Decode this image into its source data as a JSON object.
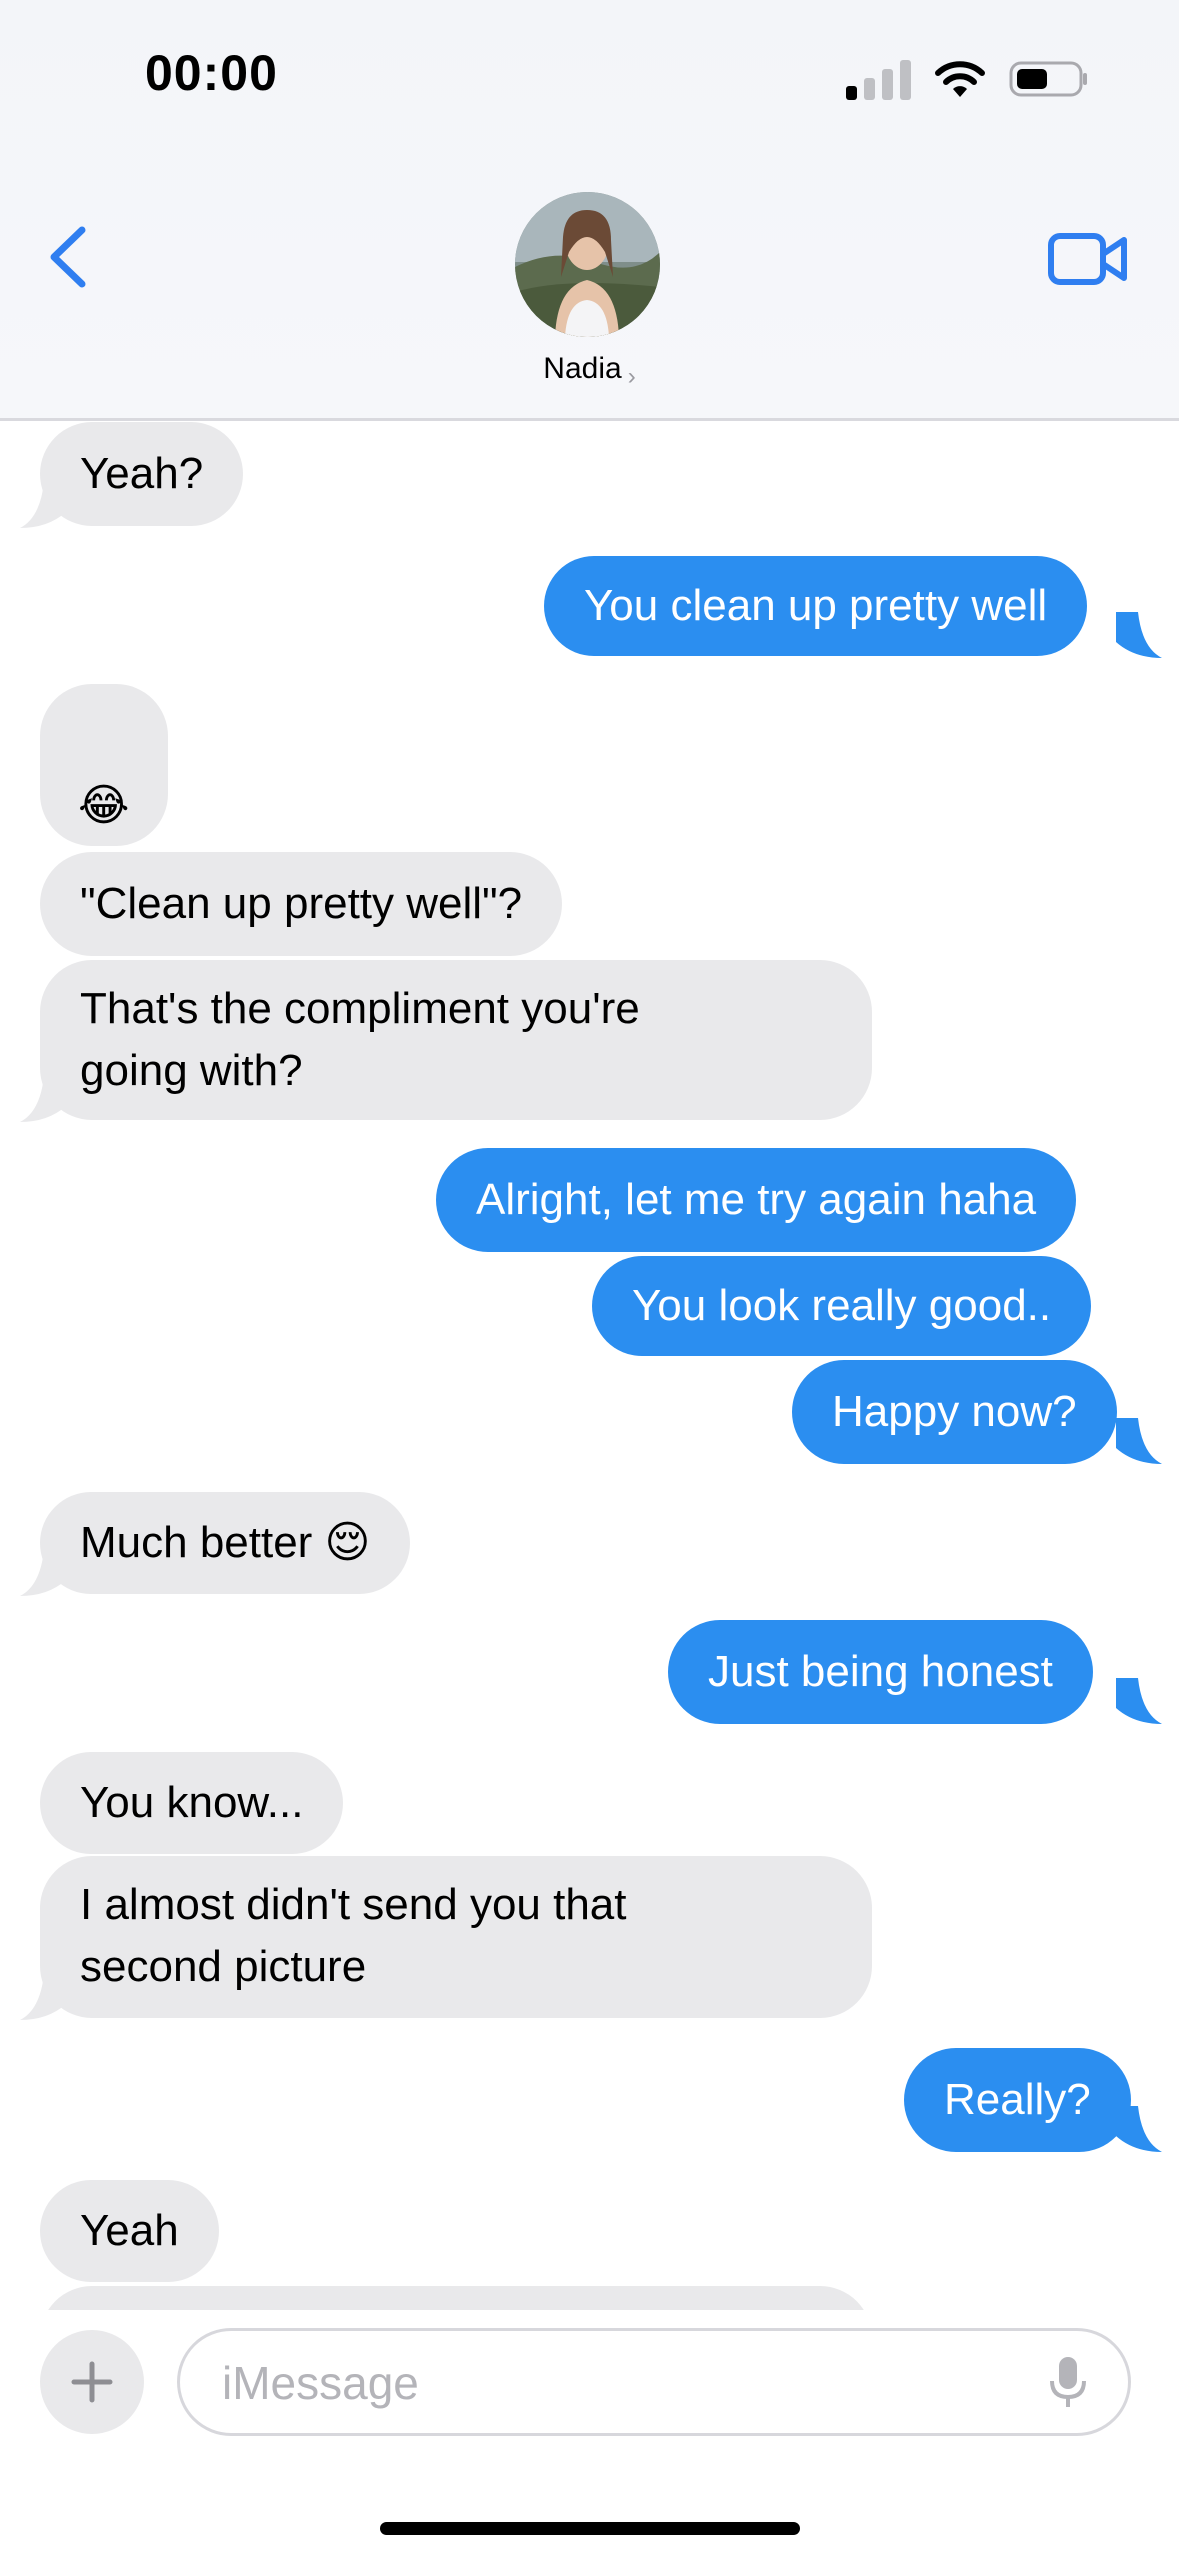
{
  "status_bar": {
    "time": "00:00",
    "battery_level": 0.5
  },
  "header": {
    "contact_name": "Nadia"
  },
  "messages": [
    {
      "from": "them",
      "text": "Yeah?"
    },
    {
      "from": "me",
      "text": "You clean up pretty well"
    },
    {
      "from": "them",
      "text": "😂"
    },
    {
      "from": "them",
      "text": "\"Clean up pretty well\"?"
    },
    {
      "from": "them",
      "line1": "That's the compliment you're",
      "line2": "going with?"
    },
    {
      "from": "me",
      "text": "Alright, let me try again haha"
    },
    {
      "from": "me",
      "text": "You look really good.."
    },
    {
      "from": "me",
      "text": "Happy now?"
    },
    {
      "from": "them",
      "text": "Much better 😌"
    },
    {
      "from": "me",
      "text": "Just being honest"
    },
    {
      "from": "them",
      "text": "You know..."
    },
    {
      "from": "them",
      "line1": "I almost didn't send you that",
      "line2": "second picture"
    },
    {
      "from": "me",
      "text": "Really?"
    },
    {
      "from": "them",
      "text": "Yeah"
    }
  ],
  "composer": {
    "placeholder": "iMessage"
  },
  "colors": {
    "outgoing": "#2b8ef0",
    "incoming": "#e9e9eb",
    "accent": "#2f7ef0"
  },
  "icons": [
    "back-chevron-icon",
    "video-camera-icon",
    "plus-icon",
    "microphone-icon",
    "signal-icon",
    "wifi-icon",
    "battery-icon"
  ]
}
